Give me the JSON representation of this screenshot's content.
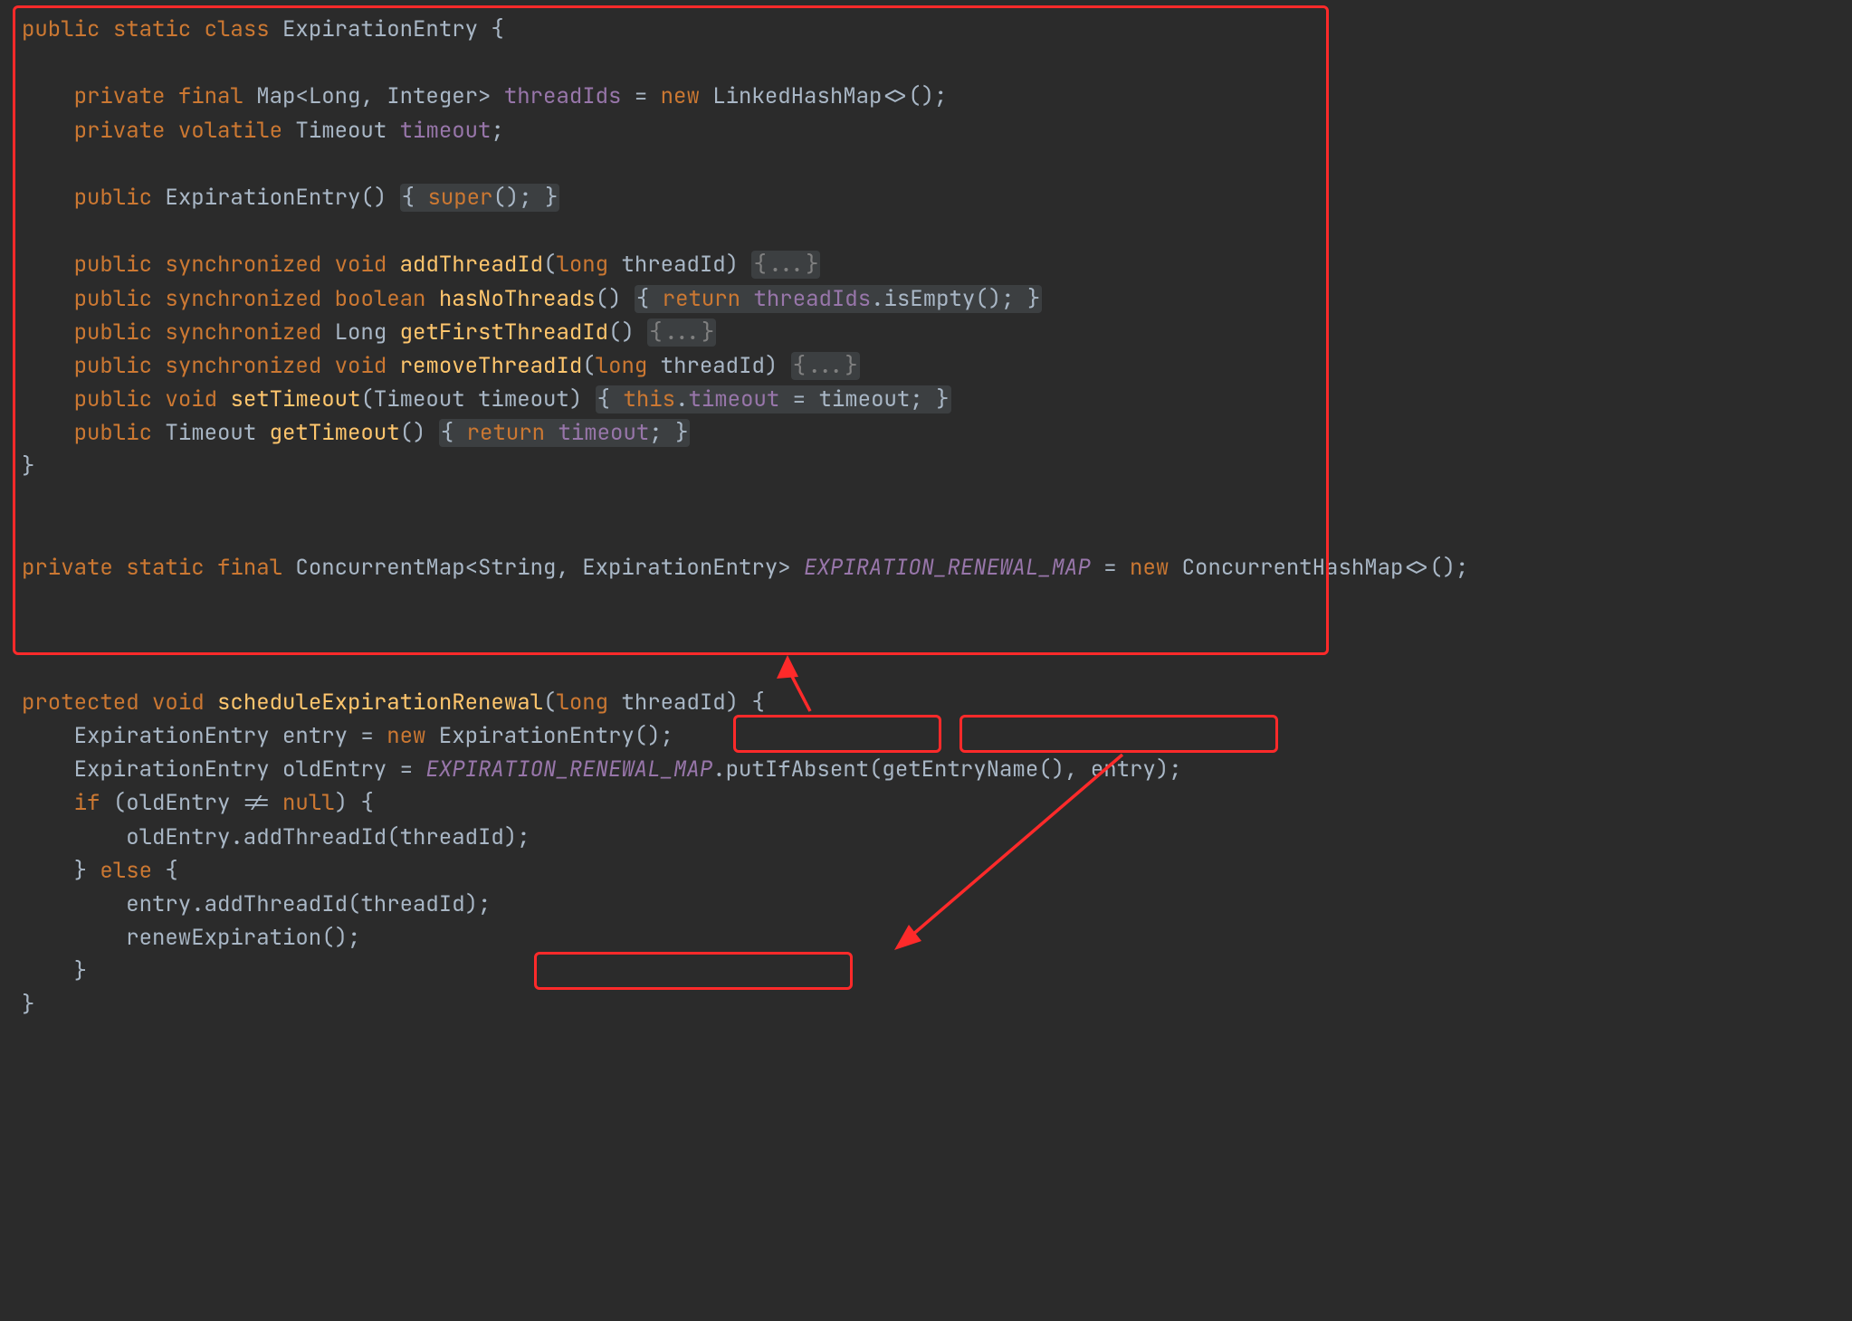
{
  "code": {
    "l1": "public static class ExpirationEntry {",
    "l1_kw1": "public",
    "l1_kw2": "static",
    "l1_kw3": "class",
    "l1_name": "ExpirationEntry",
    "l1_brace": " {",
    "l3_kw1": "private",
    "l3_kw2": "final",
    "l3_type": "Map<Long, Integer>",
    "l3_field": "threadIds",
    "l3_eq": " = ",
    "l3_kw3": "new",
    "l3_rest": " LinkedHashMap<>();",
    "l4_kw1": "private",
    "l4_kw2": "volatile",
    "l4_type": " Timeout ",
    "l4_field": "timeout",
    "l4_semi": ";",
    "l6_kw1": "public",
    "l6_ctor": "ExpirationEntry",
    "l6_parens": "() ",
    "l6_body_open": "{ ",
    "l6_super": "super",
    "l6_body_mid": "(); ",
    "l6_body_close": "}",
    "l8_kw1": "public",
    "l8_kw2": "synchronized",
    "l8_kw3": "void",
    "l8_method": "addThreadId",
    "l8_sig_open": "(",
    "l8_kw4": "long",
    "l8_sig_rest": " threadId) ",
    "l8_fold": "{...}",
    "l9_kw1": "public",
    "l9_kw2": "synchronized",
    "l9_kw3": "boolean",
    "l9_method": "hasNoThreads",
    "l9_sig": "() ",
    "l9_body_open": "{ ",
    "l9_kw4": "return",
    "l9_sp": " ",
    "l9_field": "threadIds",
    "l9_rest": ".isEmpty(); ",
    "l9_body_close": "}",
    "l10_kw1": "public",
    "l10_kw2": "synchronized",
    "l10_type": " Long ",
    "l10_method": "getFirstThreadId",
    "l10_sig": "() ",
    "l10_fold": "{...}",
    "l11_kw1": "public",
    "l11_kw2": "synchronized",
    "l11_kw3": "void",
    "l11_method": "removeThreadId",
    "l11_sig_open": "(",
    "l11_kw4": "long",
    "l11_sig_rest": " threadId) ",
    "l11_fold": "{...}",
    "l12_kw1": "public",
    "l12_kw2": "void",
    "l12_method": "setTimeout",
    "l12_sig": "(Timeout timeout) ",
    "l12_body_open": "{ ",
    "l12_kw3": "this",
    "l12_dot": ".",
    "l12_field": "timeout",
    "l12_rest": " = timeout; ",
    "l12_body_close": "}",
    "l13_kw1": "public",
    "l13_type": " Timeout ",
    "l13_method": "getTimeout",
    "l13_sig": "() ",
    "l13_body_open": "{ ",
    "l13_kw2": "return",
    "l13_sp": " ",
    "l13_field": "timeout",
    "l13_rest": "; ",
    "l13_body_close": "}",
    "l14_brace": "}",
    "l16_kw1": "private",
    "l16_kw2": "static",
    "l16_kw3": "final",
    "l16_type": " ConcurrentMap<String, ExpirationEntry> ",
    "l16_const": "EXPIRATION_RENEWAL_MAP",
    "l16_eq": " = ",
    "l16_kw4": "new",
    "l16_rest": " ConcurrentHashMap<>();",
    "l18_kw1": "protected",
    "l18_kw2": "void",
    "l18_method": "scheduleExpirationRenewal",
    "l18_sig_open": "(",
    "l18_kw3": "long",
    "l18_sig_rest": " threadId) {",
    "l19_pre": "    ExpirationEntry entry = ",
    "l19_kw": "new",
    "l19_rest": " ExpirationEntry();",
    "l20_pre": "    ExpirationEntry oldEntry = ",
    "l20_const": "EXPIRATION_RENEWAL_MAP",
    "l20_rest": ".putIfAbsent(getEntryName(), entry);",
    "l21_pre": "    ",
    "l21_kw1": "if",
    "l21_mid": " (oldEntry != ",
    "l21_kw2": "null",
    "l21_rest": ") {",
    "l22": "        oldEntry.addThreadId(threadId);",
    "l23_pre": "    } ",
    "l23_kw": "else",
    "l23_rest": " {",
    "l24": "        entry.addThreadId(threadId);",
    "l25": "        renewExpiration();",
    "l26": "    }",
    "l27": "}"
  }
}
